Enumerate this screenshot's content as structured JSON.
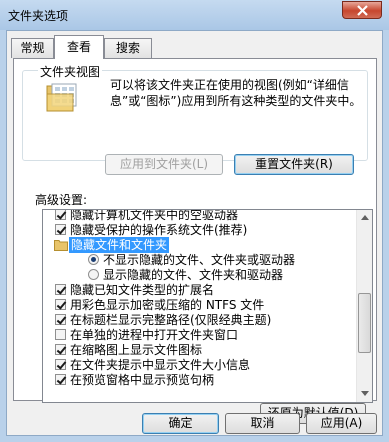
{
  "window": {
    "title": "文件夹选项"
  },
  "tabs": [
    {
      "label": "常规"
    },
    {
      "label": "查看"
    },
    {
      "label": "搜索"
    }
  ],
  "folder_views": {
    "label": "文件夹视图",
    "description": "可以将该文件夹正在使用的视图(例如“详细信息”或“图标”)应用到所有这种类型的文件夹中。",
    "apply_button": "应用到文件夹(L)",
    "reset_button": "重置文件夹(R)"
  },
  "advanced": {
    "label": "高级设置:",
    "items": [
      {
        "text": "隐藏计算机文件夹中的空驱动器",
        "checked": true
      },
      {
        "text": "隐藏受保护的操作系统文件(推荐)",
        "checked": true
      },
      {
        "text": "隐藏文件和文件夹",
        "selected": true
      },
      {
        "text": "不显示隐藏的文件、文件夹或驱动器",
        "checked": true
      },
      {
        "text": "显示隐藏的文件、文件夹和驱动器",
        "checked": false
      },
      {
        "text": "隐藏已知文件类型的扩展名",
        "checked": true
      },
      {
        "text": "用彩色显示加密或压缩的 NTFS 文件",
        "checked": true
      },
      {
        "text": "在标题栏显示完整路径(仅限经典主题)",
        "checked": true
      },
      {
        "text": "在单独的进程中打开文件夹窗口",
        "checked": false
      },
      {
        "text": "在缩略图上显示文件图标",
        "checked": true
      },
      {
        "text": "在文件夹提示中显示文件大小信息",
        "checked": true
      },
      {
        "text": "在预览窗格中显示预览句柄",
        "checked": true
      }
    ]
  },
  "restore_defaults": "还原为默认值(D)",
  "footer": {
    "ok": "确定",
    "cancel": "取消",
    "apply": "应用(A)"
  }
}
